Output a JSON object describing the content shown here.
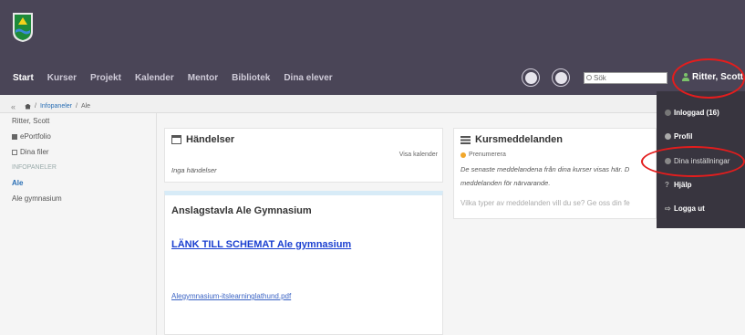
{
  "header": {
    "nav": [
      "Start",
      "Kurser",
      "Projekt",
      "Kalender",
      "Mentor",
      "Bibliotek",
      "Dina elever"
    ],
    "search_placeholder": "Sök",
    "user_name": "Ritter, Scott",
    "user_caret": "▾"
  },
  "breadcrumb": {
    "collapse": "«",
    "items": [
      "Infopaneler",
      "Ale"
    ],
    "separator": "/"
  },
  "sidebar": {
    "user": "Ritter, Scott",
    "eportfolio": "ePortfolio",
    "files": "Dina filer",
    "section": "INFOPANELER",
    "active": "Ale",
    "item": "Ale gymnasium"
  },
  "events": {
    "title": "Händelser",
    "link": "Visa kalender",
    "empty": "Inga händelser"
  },
  "course_messages": {
    "title": "Kursmeddelanden",
    "subscribe": "Prenumerera",
    "text1": "De senaste meddelandena från dina kurser visas här. D",
    "text2": "meddelanden för närvarande.",
    "text3": "Vilka typer av meddelanden vill du se? Ge oss din fe"
  },
  "board": {
    "title": "Anslagstavla Ale Gymnasium",
    "schedule_link": "LÄNK TILL SCHEMAT Ale gymnasium",
    "pdf_link": "Alegymnasium-itslearninglathund.pdf"
  },
  "dropdown": {
    "logged_in": "Inloggad (16)",
    "profile": "Profil",
    "settings": "Dina inställningar",
    "help": "Hjälp",
    "logout": "Logga ut",
    "help_glyph": "?",
    "logout_glyph": "⇨"
  },
  "colors": {
    "topbar": "#4a4557",
    "dropdown": "#38353f",
    "annotation": "#e31d1d",
    "link": "#1a3fd0"
  }
}
